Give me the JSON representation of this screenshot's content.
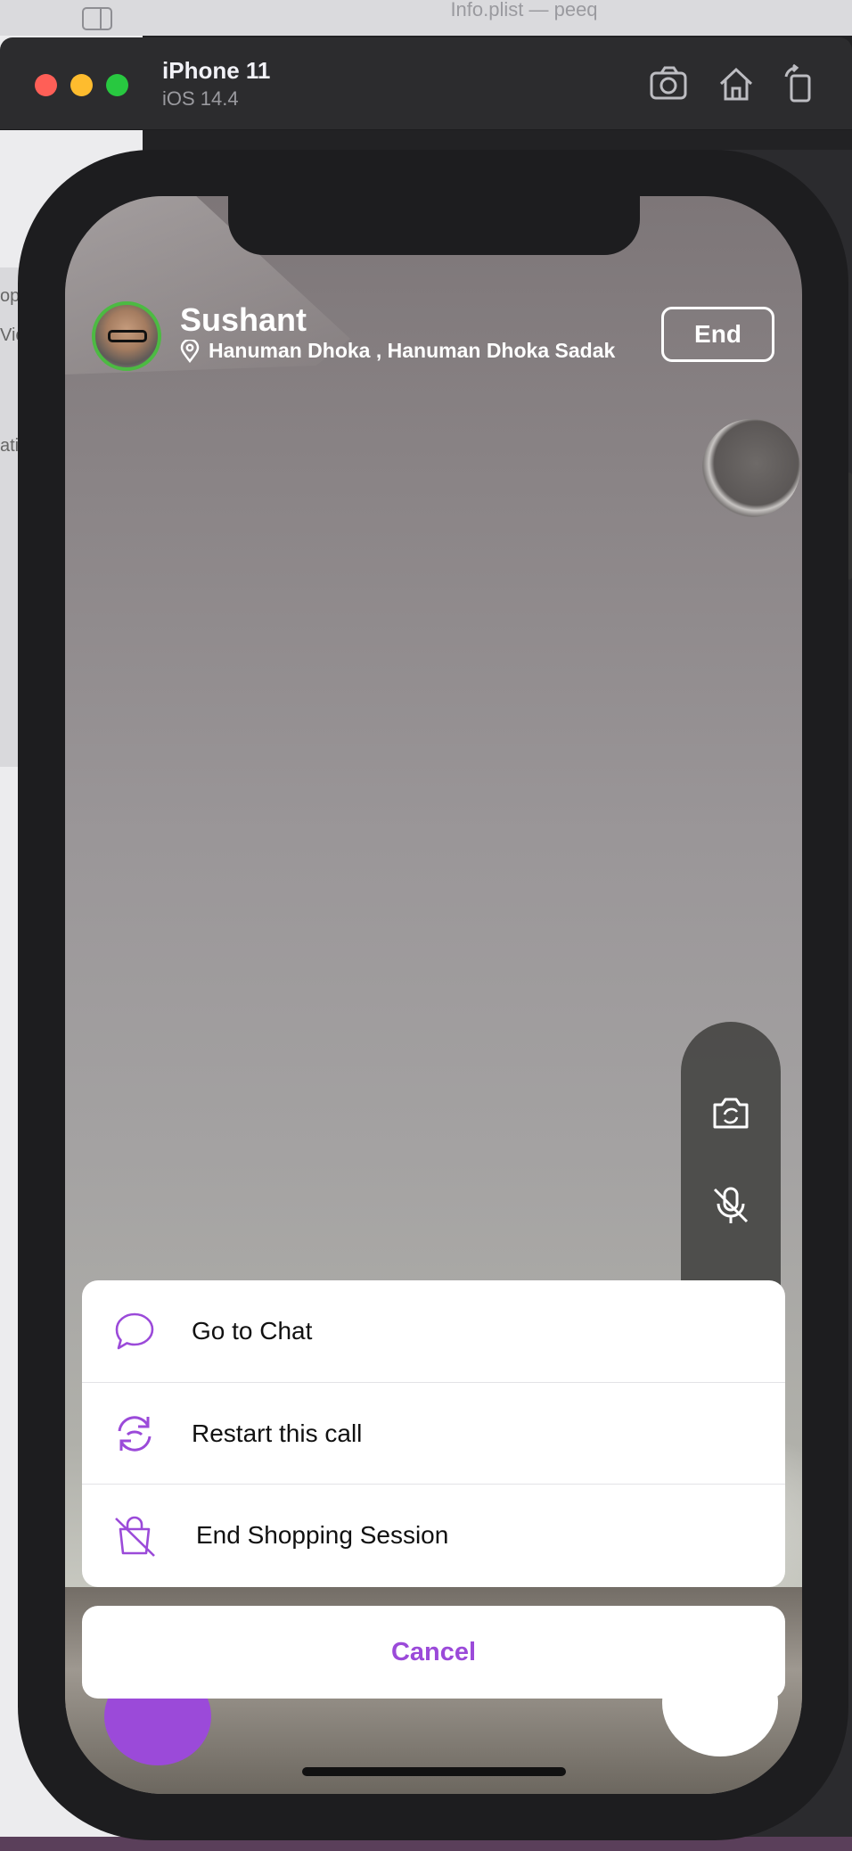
{
  "background": {
    "document_title": "Info.plist — peeq",
    "left_fragments": [
      "op",
      "Vic",
      "ati"
    ]
  },
  "simulator": {
    "device_name": "iPhone 11",
    "os_version": "iOS 14.4",
    "toolbar_icons": [
      "screenshot-icon",
      "home-icon",
      "rotate-icon"
    ]
  },
  "call": {
    "caller_name": "Sushant",
    "location": "Hanuman Dhoka , Hanuman Dhoka Sadak",
    "end_label": "End",
    "controls": [
      "switch-camera-icon",
      "mic-off-icon"
    ]
  },
  "action_sheet": {
    "items": [
      {
        "label": "Go to Chat",
        "icon": "chat-bubble-icon"
      },
      {
        "label": "Restart this call",
        "icon": "restart-call-icon"
      },
      {
        "label": "End Shopping Session",
        "icon": "shopping-bag-off-icon"
      }
    ],
    "cancel_label": "Cancel"
  },
  "colors": {
    "accent": "#9b4ad9",
    "avatar_ring": "#4cba42"
  }
}
